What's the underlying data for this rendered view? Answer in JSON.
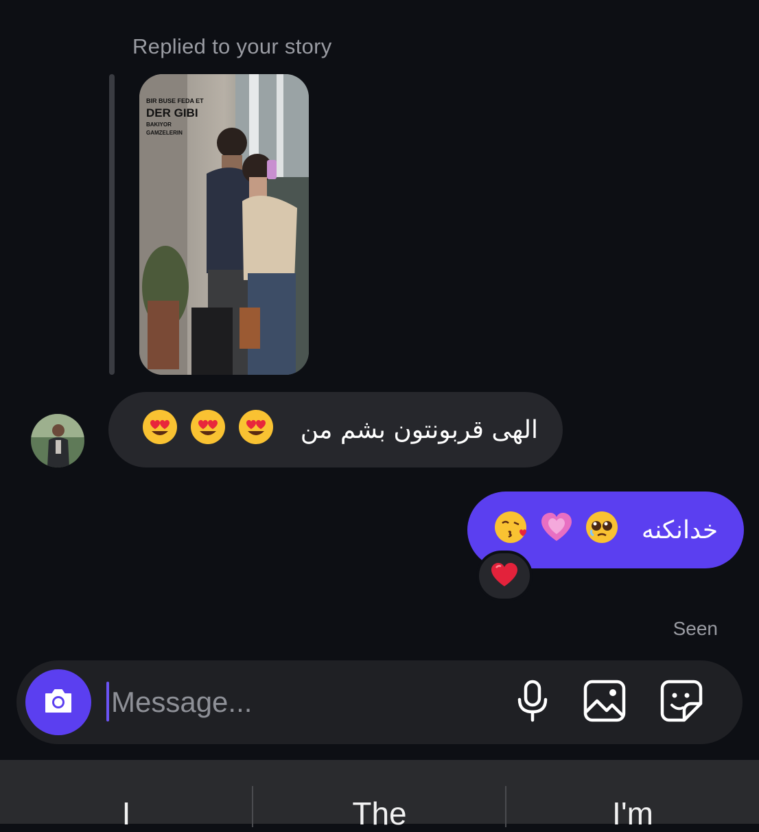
{
  "thread": {
    "reply_caption": "Replied to your story",
    "story": {
      "text_line1": "BIR BUSE FEDA ET",
      "text_line2": "DER GIBI",
      "text_line3": "BAKIYOR",
      "text_line4": "GAMZELERIN"
    },
    "incoming_message": {
      "text": "الهی قربونتون بشم من",
      "emojis": [
        "heart-eyes-face",
        "heart-eyes-face",
        "heart-eyes-face"
      ]
    },
    "outgoing_message": {
      "text": "خدانکنه",
      "emojis": [
        "pleading-face",
        "growing-heart",
        "face-blowing-kiss"
      ]
    },
    "reaction": "red-heart",
    "seen_label": "Seen"
  },
  "composer": {
    "placeholder": "Message...",
    "icons": [
      "camera-icon",
      "microphone-icon",
      "gallery-icon",
      "sticker-icon"
    ]
  },
  "keyboard": {
    "suggestions": [
      "I",
      "The",
      "I'm"
    ]
  },
  "colors": {
    "background": "#0d0f14",
    "incoming_bubble": "#26272c",
    "outgoing_bubble": "#5b3ff0",
    "accent": "#5b3ff0"
  }
}
